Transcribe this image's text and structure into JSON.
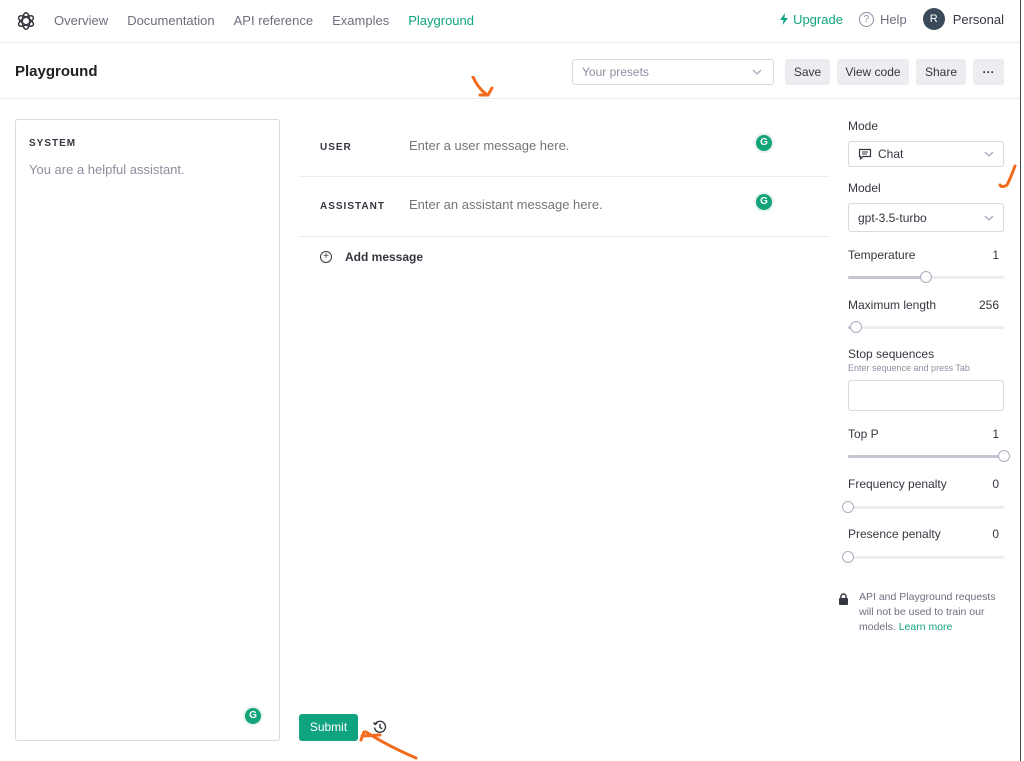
{
  "nav": {
    "logo": "openai-logo-icon",
    "links": [
      {
        "label": "Overview",
        "active": false
      },
      {
        "label": "Documentation",
        "active": false
      },
      {
        "label": "API reference",
        "active": false
      },
      {
        "label": "Examples",
        "active": false
      },
      {
        "label": "Playground",
        "active": true
      }
    ],
    "upgrade_label": "Upgrade",
    "help_label": "Help",
    "help_icon_glyph": "?",
    "account_initial": "R",
    "account_label": "Personal"
  },
  "header": {
    "title": "Playground",
    "presets_placeholder": "Your presets",
    "save_label": "Save",
    "view_code_label": "View code",
    "share_label": "Share",
    "more_label": "···"
  },
  "system": {
    "label": "SYSTEM",
    "text": "You are a helpful assistant."
  },
  "messages": [
    {
      "role": "USER",
      "placeholder": "Enter a user message here.",
      "value": ""
    },
    {
      "role": "ASSISTANT",
      "placeholder": "Enter an assistant message here.",
      "value": ""
    }
  ],
  "add_message_label": "Add message",
  "add_message_glyph": "+",
  "sidebar": {
    "mode_label": "Mode",
    "mode_value": "Chat",
    "model_label": "Model",
    "model_value": "gpt-3.5-turbo",
    "temperature": {
      "label": "Temperature",
      "value": "1",
      "fraction": 0.5
    },
    "max_length": {
      "label": "Maximum length",
      "value": "256",
      "fraction": 0.05
    },
    "stop_sequences": {
      "label": "Stop sequences",
      "hint": "Enter sequence and press Tab",
      "value": ""
    },
    "top_p": {
      "label": "Top P",
      "value": "1",
      "fraction": 1.0
    },
    "frequency_penalty": {
      "label": "Frequency penalty",
      "value": "0",
      "fraction": 0.0
    },
    "presence_penalty": {
      "label": "Presence penalty",
      "value": "0",
      "fraction": 0.0
    },
    "privacy_text": "API and Playground requests will not be used to train our models.",
    "learn_more_label": "Learn more"
  },
  "footer": {
    "submit_label": "Submit"
  },
  "colors": {
    "accent": "#10a37f",
    "annotation": "#f26b1d"
  }
}
